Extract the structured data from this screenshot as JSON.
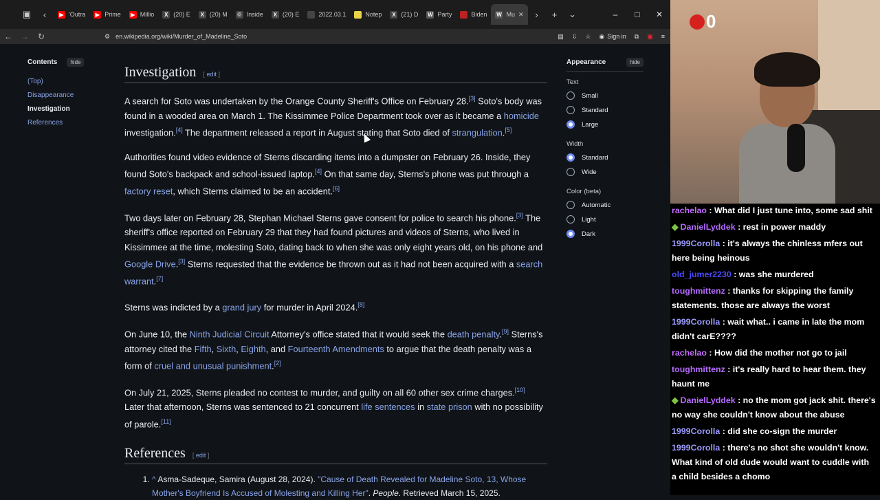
{
  "browser": {
    "tabs": [
      {
        "label": "'Outra",
        "color": "#ff0000",
        "glyph": "▶"
      },
      {
        "label": "Prime",
        "color": "#ff0000",
        "glyph": "▶"
      },
      {
        "label": "Millio",
        "color": "#ff0000",
        "glyph": "▶"
      },
      {
        "label": "(20) E",
        "color": "#444",
        "glyph": "X"
      },
      {
        "label": "(20) M",
        "color": "#444",
        "glyph": "X"
      },
      {
        "label": "Inside",
        "color": "#444",
        "glyph": "©"
      },
      {
        "label": "(20) E",
        "color": "#444",
        "glyph": "X"
      },
      {
        "label": "2022.03.1",
        "color": "#444",
        "glyph": ""
      },
      {
        "label": "Notep",
        "color": "#e8d34a",
        "glyph": ""
      },
      {
        "label": "(21) D",
        "color": "#444",
        "glyph": "X"
      },
      {
        "label": "Party",
        "color": "#555",
        "glyph": "W"
      },
      {
        "label": "Biden",
        "color": "#b22",
        "glyph": ""
      },
      {
        "label": "Mu",
        "color": "#555",
        "glyph": "W"
      }
    ],
    "url": "en.wikipedia.org/wiki/Murder_of_Madeline_Soto",
    "signin": "Sign in"
  },
  "toc": {
    "title": "Contents",
    "hide": "hide",
    "items": [
      "(Top)",
      "Disappearance",
      "Investigation",
      "References"
    ]
  },
  "article": {
    "section_title": "Investigation",
    "edit": "edit",
    "references_title": "References"
  },
  "appearance": {
    "title": "Appearance",
    "hide": "hide",
    "text_label": "Text",
    "text_options": [
      "Small",
      "Standard",
      "Large"
    ],
    "width_label": "Width",
    "width_options": [
      "Standard",
      "Wide"
    ],
    "color_label": "Color (beta)",
    "color_options": [
      "Automatic",
      "Light",
      "Dark"
    ]
  },
  "stream": {
    "badge_count": "0",
    "chat": [
      {
        "user": "rachelao",
        "color": "#c36bff",
        "text": ": What did I just tune into, some sad shit",
        "diamond": false
      },
      {
        "user": "DanielLyddek",
        "color": "#b56cff",
        "text": ": rest in power maddy",
        "diamond": true
      },
      {
        "user": "1999Corolla",
        "color": "#9c9cff",
        "text": ": it's always the chinless mfers out here being heinous",
        "diamond": false
      },
      {
        "user": "old_jumer2230",
        "color": "#4a4aff",
        "text": ": was she murdered",
        "diamond": false
      },
      {
        "user": "toughmittenz",
        "color": "#b56cff",
        "text": ": thanks for skipping the family statements. those are always the worst",
        "diamond": false
      },
      {
        "user": "1999Corolla",
        "color": "#9c9cff",
        "text": ": wait what.. i came in late the mom didn't carE????",
        "diamond": false
      },
      {
        "user": "rachelao",
        "color": "#c36bff",
        "text": ": How did the mother not go to jail",
        "diamond": false
      },
      {
        "user": "toughmittenz",
        "color": "#b56cff",
        "text": ": it's really hard to hear them. they haunt me",
        "diamond": false
      },
      {
        "user": "DanielLyddek",
        "color": "#b56cff",
        "text": ": no the mom got jack shit. there's no way she couldn't know about the abuse",
        "diamond": true
      },
      {
        "user": "1999Corolla",
        "color": "#9c9cff",
        "text": ": did she co-sign the murder",
        "diamond": false
      },
      {
        "user": "1999Corolla",
        "color": "#9c9cff",
        "text": ": there's no shot she wouldn't know. What kind of old dude would want to cuddle with a child besides a chomo",
        "diamond": false
      }
    ]
  }
}
